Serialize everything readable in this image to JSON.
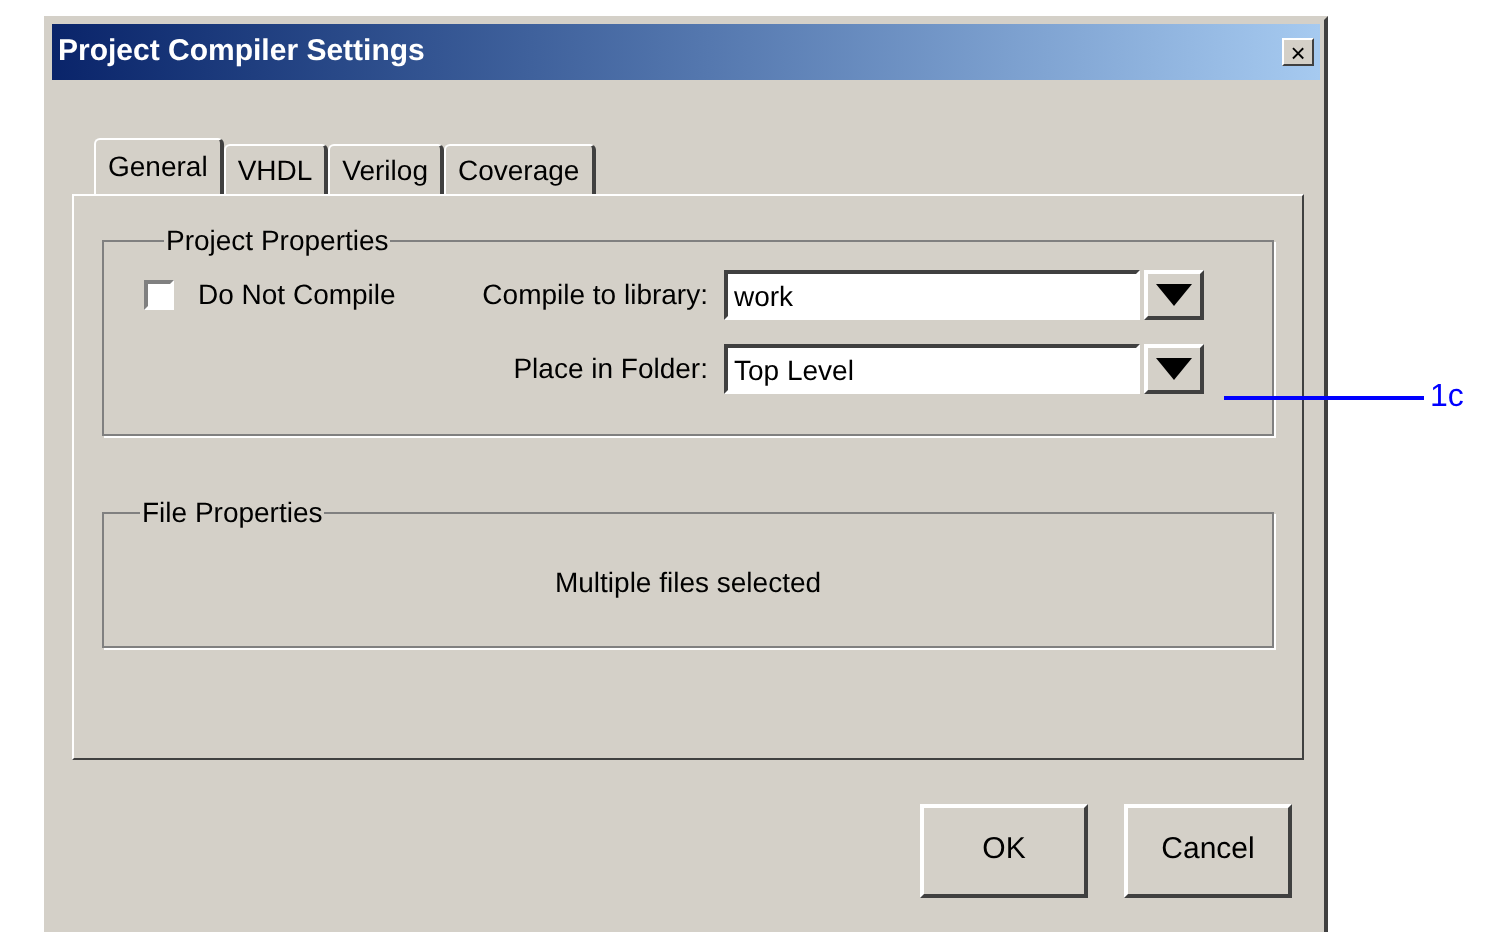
{
  "window": {
    "title": "Project Compiler Settings",
    "close": "×"
  },
  "tabs": [
    {
      "label": "General",
      "selected": true
    },
    {
      "label": "VHDL",
      "selected": false
    },
    {
      "label": "Verilog",
      "selected": false
    },
    {
      "label": "Coverage",
      "selected": false
    }
  ],
  "project_properties": {
    "title": "Project Properties",
    "do_not_compile": {
      "label": "Do Not Compile",
      "checked": false
    },
    "fields": [
      {
        "label": "Compile to library:",
        "value": "work"
      },
      {
        "label": "Place in Folder:",
        "value": "Top Level"
      }
    ]
  },
  "file_properties": {
    "title": "File Properties",
    "message": "Multiple files selected"
  },
  "buttons": [
    "OK",
    "Cancel"
  ],
  "callout": {
    "label": "1c"
  }
}
